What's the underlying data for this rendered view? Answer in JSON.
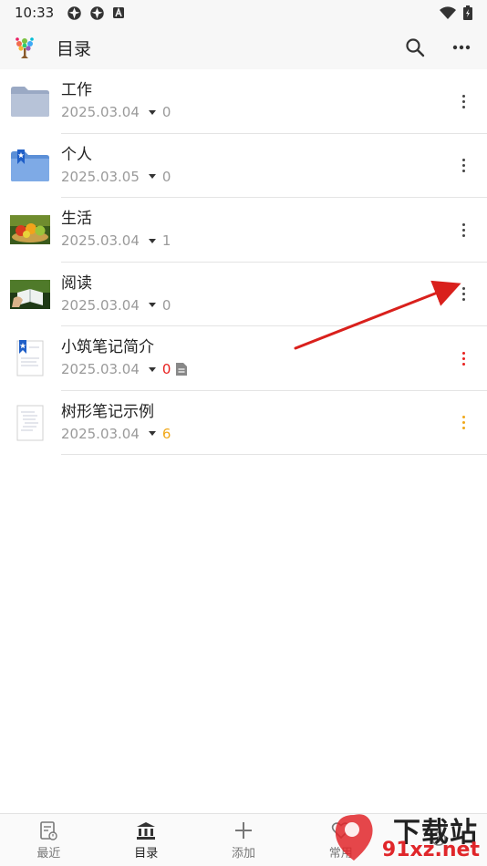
{
  "status": {
    "time": "10:33"
  },
  "appbar": {
    "title": "目录"
  },
  "items": [
    {
      "title": "工作",
      "date": "2025.03.04",
      "count": "0",
      "count_color": "#9a9a9a",
      "more_color": "#444444",
      "icon": "folder-icon"
    },
    {
      "title": "个人",
      "date": "2025.03.05",
      "count": "0",
      "count_color": "#9a9a9a",
      "more_color": "#444444",
      "icon": "folder-bookmark-icon"
    },
    {
      "title": "生活",
      "date": "2025.03.04",
      "count": "1",
      "count_color": "#9a9a9a",
      "more_color": "#444444",
      "icon": "fruit-photo-icon"
    },
    {
      "title": "阅读",
      "date": "2025.03.04",
      "count": "0",
      "count_color": "#9a9a9a",
      "more_color": "#444444",
      "icon": "reading-photo-icon"
    },
    {
      "title": "小筑笔记简介",
      "date": "2025.03.04",
      "count": "0",
      "count_color": "#e8201e",
      "more_color": "#e8201e",
      "icon": "note-bookmark-icon"
    },
    {
      "title": "树形笔记示例",
      "date": "2025.03.04",
      "count": "6",
      "count_color": "#f0a81a",
      "more_color": "#f0a81a",
      "icon": "note-page-icon"
    }
  ],
  "nav": [
    {
      "label": "最近",
      "icon": "recent-note-icon"
    },
    {
      "label": "目录",
      "icon": "library-icon"
    },
    {
      "label": "添加",
      "icon": "plus-icon"
    },
    {
      "label": "常用",
      "icon": "heart-icon"
    },
    {
      "label": "",
      "icon": "settings-icon"
    }
  ],
  "watermark": {
    "line1": "下载站",
    "line2": "91xz.net"
  },
  "colors": {
    "accent_red": "#e8201e",
    "accent_orange": "#f0a81a"
  }
}
